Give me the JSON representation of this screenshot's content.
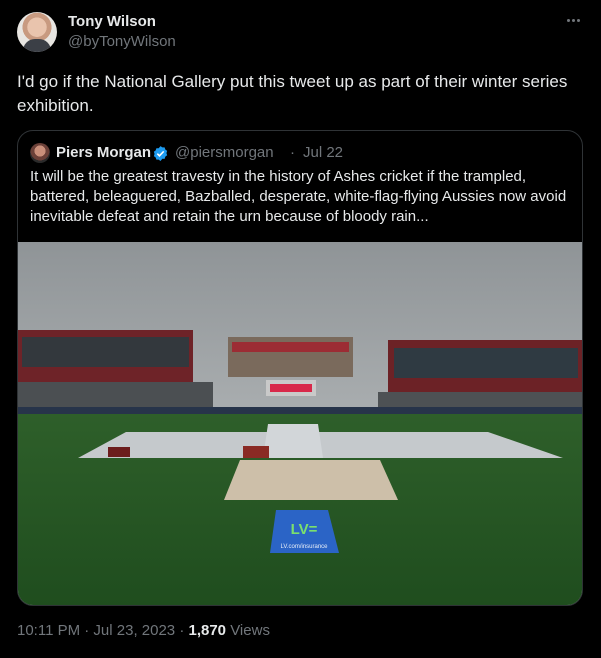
{
  "author": {
    "name": "Tony Wilson",
    "handle": "@byTonyWilson"
  },
  "tweet": {
    "text": "I'd go if the National Gallery put this tweet up as part of their winter series exhibition."
  },
  "quoted": {
    "name": "Piers Morgan",
    "handle": "@piersmorgan",
    "separator": "·",
    "date": "Jul 22",
    "text": "It will be the greatest travesty in the history of Ashes cricket if the trampled, battered, beleaguered, Bazballed, desperate, white-flag-flying Aussies now avoid inevitable defeat and retain the urn because of bloody rain...",
    "photo": {
      "sponsor_text": "LV=",
      "sponsor_url": "LV.com/insurance"
    }
  },
  "meta": {
    "time": "10:11 PM · Jul 23, 2023 · ",
    "views_count": "1,870",
    "views_label": " Views"
  },
  "colors": {
    "background": "#000000",
    "text": "#e7e9ea",
    "secondary": "#71767b",
    "border": "#2f3336",
    "verified": "#1d9bf0"
  },
  "icons": {
    "more": "more-icon",
    "verified": "verified-icon"
  }
}
